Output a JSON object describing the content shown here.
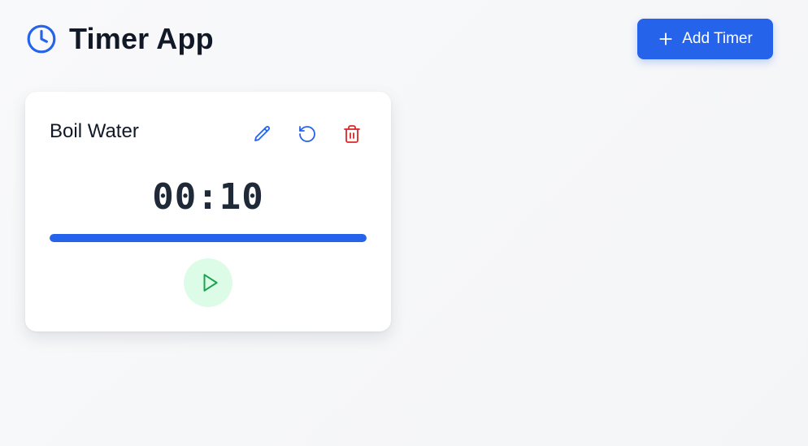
{
  "header": {
    "title": "Timer App",
    "icon": "clock-icon",
    "add_button_label": "Add Timer",
    "add_button_icon": "plus-icon"
  },
  "timers": [
    {
      "name": "Boil Water",
      "time": "00:10",
      "progress": 1.0,
      "actions": [
        "pencil-icon",
        "reset-icon",
        "trash-icon"
      ],
      "control_icon": "play-icon"
    }
  ],
  "colors": {
    "accent": "#2563eb",
    "danger": "#dc2626",
    "play": "#16a34a",
    "play_bg": "#dcfce7"
  }
}
